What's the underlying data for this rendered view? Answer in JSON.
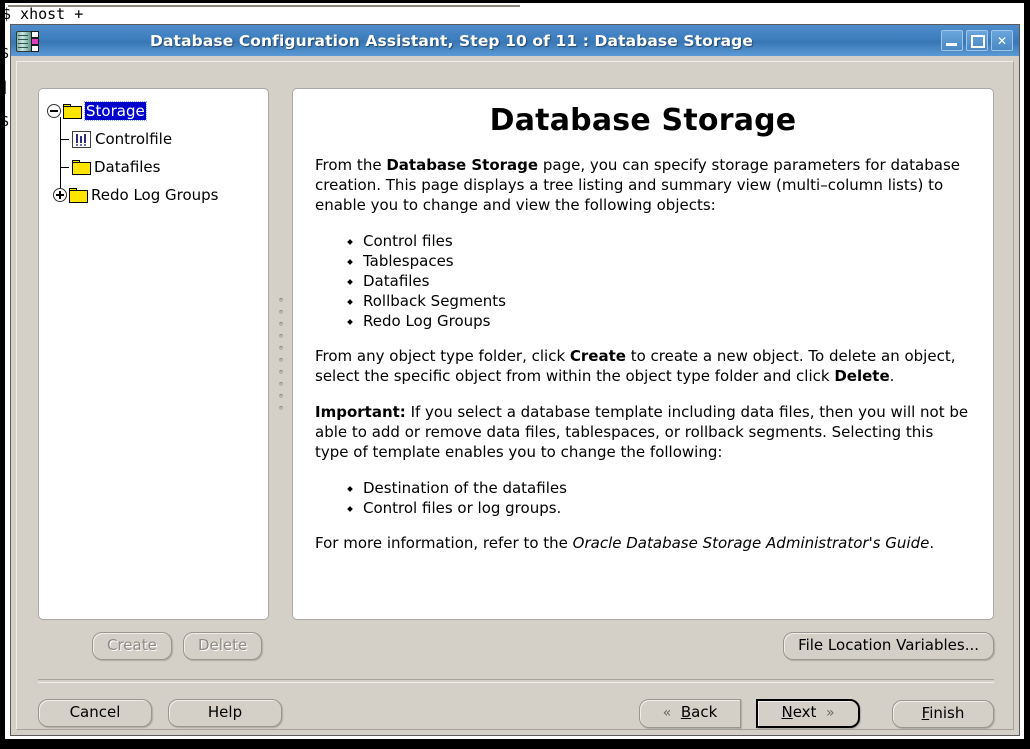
{
  "desktop": {
    "terminal_line1": "$ xhost +",
    "terminal_line2": "",
    "terminal_left_chars": "$\n]:\n$"
  },
  "window": {
    "title": "Database Configuration Assistant, Step 10 of 11 : Database Storage",
    "icon": "database-icon",
    "controls": {
      "minimize": "minimize-icon",
      "maximize": "maximize-icon",
      "close": "✕"
    }
  },
  "tree": {
    "nodes": [
      {
        "label": "Storage",
        "icon": "folder-icon",
        "handle": "collapse-handle",
        "selected": true,
        "level": 0
      },
      {
        "label": "Controlfile",
        "icon": "controlfile-icon",
        "handle": "none",
        "selected": false,
        "level": 1
      },
      {
        "label": "Datafiles",
        "icon": "folder-icon",
        "handle": "none",
        "selected": false,
        "level": 1
      },
      {
        "label": "Redo Log Groups",
        "icon": "folder-icon",
        "handle": "expand-handle",
        "selected": false,
        "level": 1
      }
    ]
  },
  "page": {
    "title": "Database Storage",
    "intro_1": "From the ",
    "intro_bold": "Database Storage",
    "intro_2": " page, you can specify storage parameters for database creation. This page displays a tree listing and summary view (multi–column lists) to enable you to change and view the following objects:",
    "objects": [
      "Control files",
      "Tablespaces",
      "Datafiles",
      "Rollback Segments",
      "Redo Log Groups"
    ],
    "create_delete_1": "From any object type folder, click ",
    "create_delete_bold1": "Create",
    "create_delete_2": " to create a new object. To delete an object, select the specific object from within the object type folder and click ",
    "create_delete_bold2": "Delete",
    "create_delete_3": ".",
    "important_label": "Important:",
    "important_text": " If you select a database template including data files, then you will not be able to add or remove data files, tablespaces, or rollback segments. Selecting this type of template enables you to change the following:",
    "template_changes": [
      "Destination of the datafiles",
      "Control files or log groups."
    ],
    "more_info_1": "For more information, refer to the ",
    "more_info_italic": "Oracle Database Storage Administrator's Guide",
    "more_info_2": "."
  },
  "buttons": {
    "create": "Create",
    "delete": "Delete",
    "file_location_variables": "File Location Variables...",
    "cancel": "Cancel",
    "help": "Help",
    "back": "Back",
    "back_mnemonic": "B",
    "back_icon": "«",
    "next": "Next",
    "next_mnemonic": "N",
    "next_icon": "»",
    "finish": "Finish",
    "finish_mnemonic": "F"
  },
  "colors": {
    "titlebar_accent": "#3e7ebd",
    "dialog_face": "#d4d0c8",
    "selection": "#0000cd",
    "folder": "#ffe400",
    "panel_bg": "#ffffff"
  }
}
